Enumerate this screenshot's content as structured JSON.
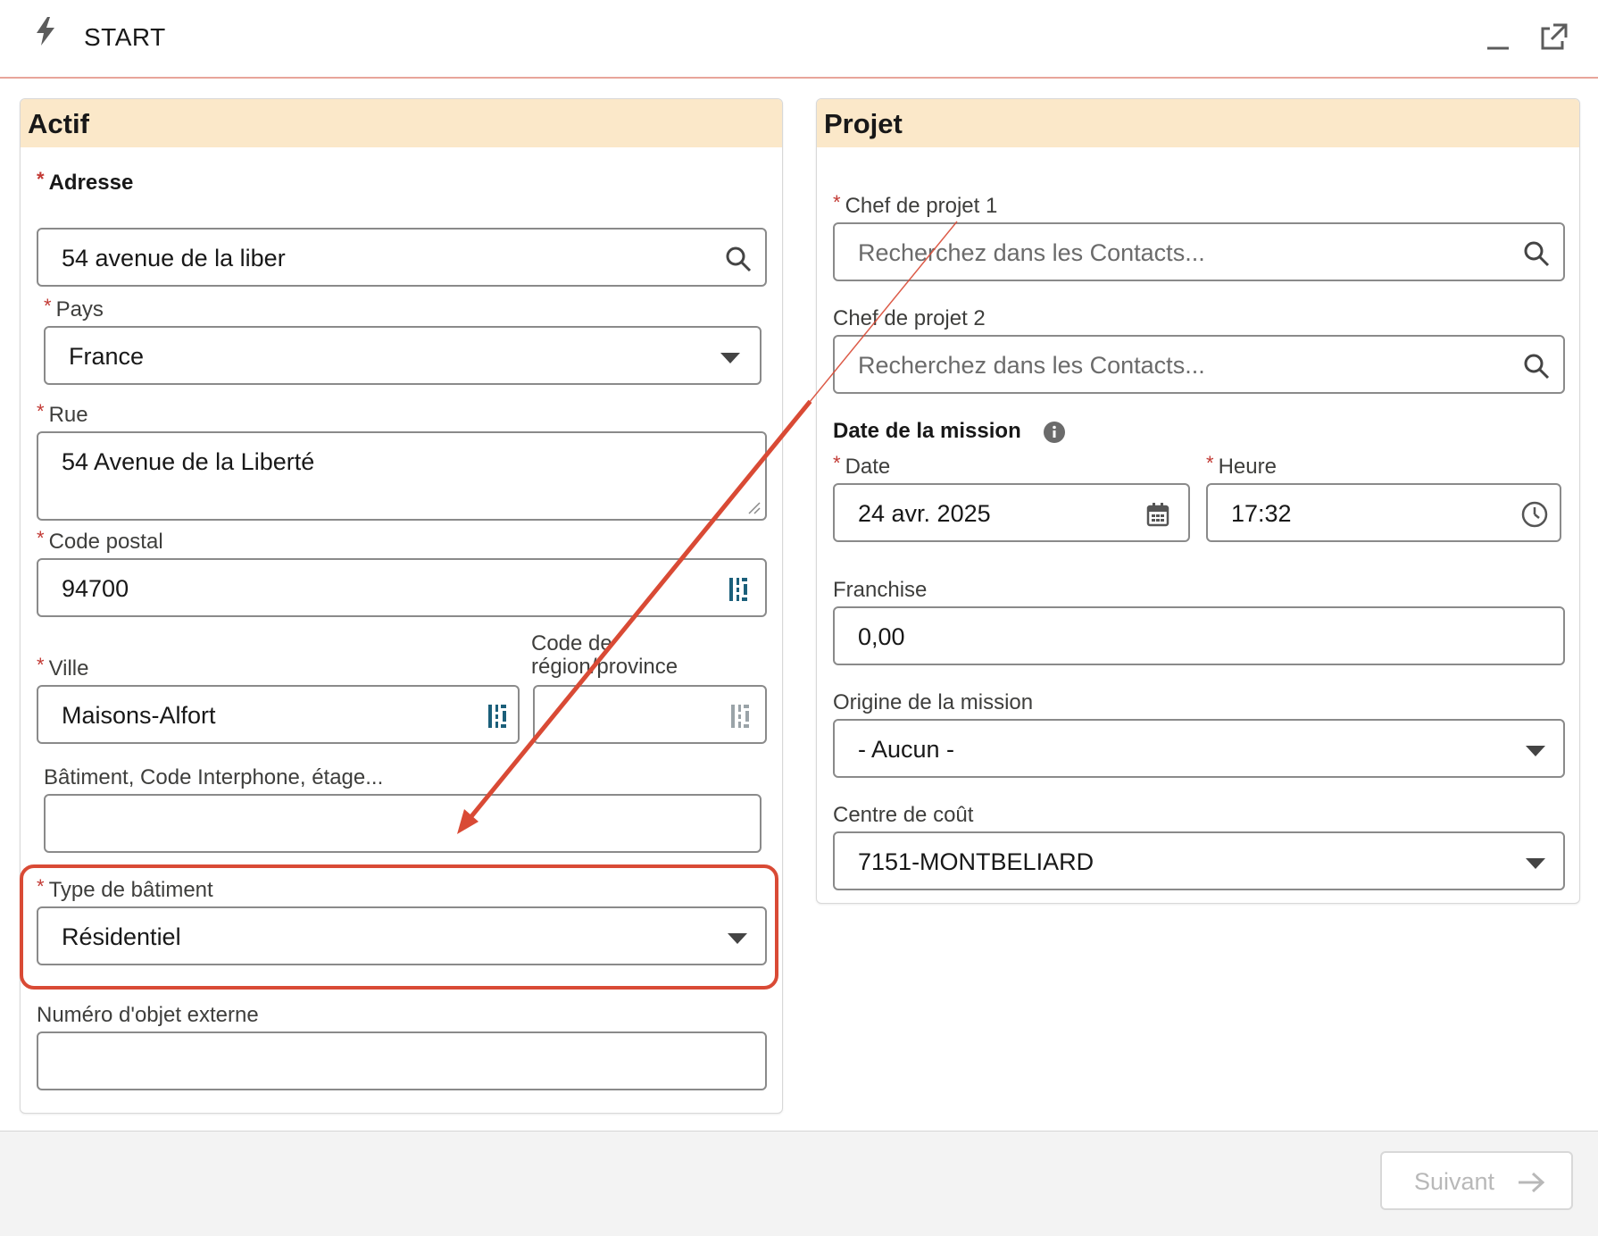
{
  "header": {
    "title": "START",
    "icon": "bolt-icon",
    "minimize_icon": "minimize-icon",
    "popout_icon": "popout-icon"
  },
  "actif": {
    "title": "Actif",
    "address_label": "Adresse",
    "address_value": "54 avenue de la liber",
    "country_label": "Pays",
    "country_value": "France",
    "street_label": "Rue",
    "street_value": "54 Avenue de la Liberté",
    "postal_label": "Code postal",
    "postal_value": "94700",
    "city_label": "Ville",
    "city_value": "Maisons-Alfort",
    "region_label_line1": "Code de",
    "region_label_line2": "région/province",
    "region_value": "",
    "building_info_label": "Bâtiment, Code Interphone, étage...",
    "building_info_value": "",
    "building_type_label": "Type de bâtiment",
    "building_type_value": "Résidentiel",
    "external_id_label": "Numéro d'objet externe",
    "external_id_value": ""
  },
  "projet": {
    "title": "Projet",
    "manager1_label": "Chef de projet 1",
    "manager1_placeholder": "Recherchez dans les Contacts...",
    "manager2_label": "Chef de projet 2",
    "manager2_placeholder": "Recherchez dans les Contacts...",
    "mission_date_label": "Date de la mission",
    "date_label": "Date",
    "date_value": "24 avr. 2025",
    "time_label": "Heure",
    "time_value": "17:32",
    "franchise_label": "Franchise",
    "franchise_value": "0,00",
    "origin_label": "Origine de la mission",
    "origin_value": "- Aucun -",
    "cost_center_label": "Centre de coût",
    "cost_center_value": "7151-MONTBELIARD"
  },
  "footer": {
    "next_label": "Suivant"
  },
  "colors": {
    "accent": "#d94a35",
    "panel_header": "#fbe8c9",
    "required": "#c23934"
  }
}
